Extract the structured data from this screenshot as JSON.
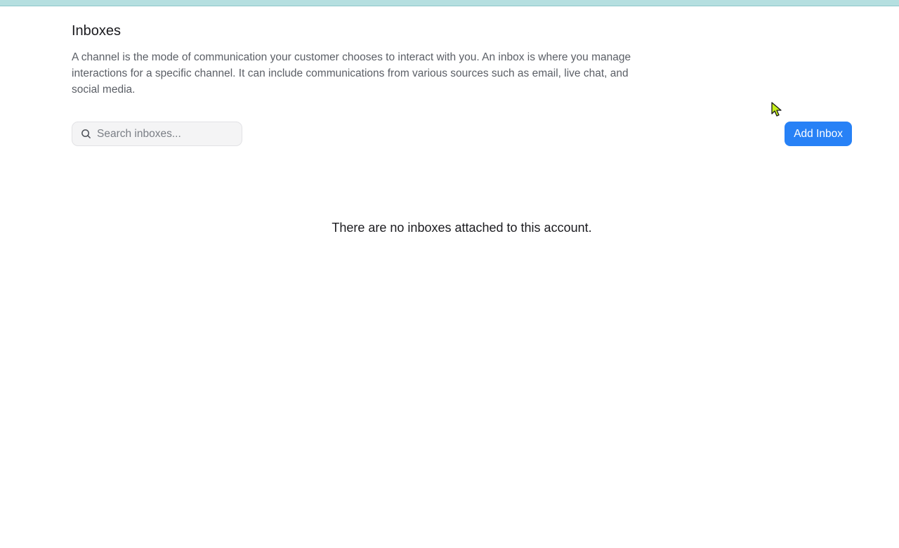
{
  "header": {
    "title": "Inboxes",
    "description": "A channel is the mode of communication your customer chooses to interact with you. An inbox is where you manage interactions for a specific channel. It can include communications from various sources such as email, live chat, and social media."
  },
  "toolbar": {
    "search": {
      "placeholder": "Search inboxes...",
      "value": "",
      "icon": "search-icon"
    },
    "add_button_label": "Add Inbox"
  },
  "empty_state": {
    "message": "There are no inboxes attached to this account."
  },
  "colors": {
    "accent": "#2781f6",
    "top_band": "#b5dfe0",
    "cursor": "#c6f01b"
  }
}
